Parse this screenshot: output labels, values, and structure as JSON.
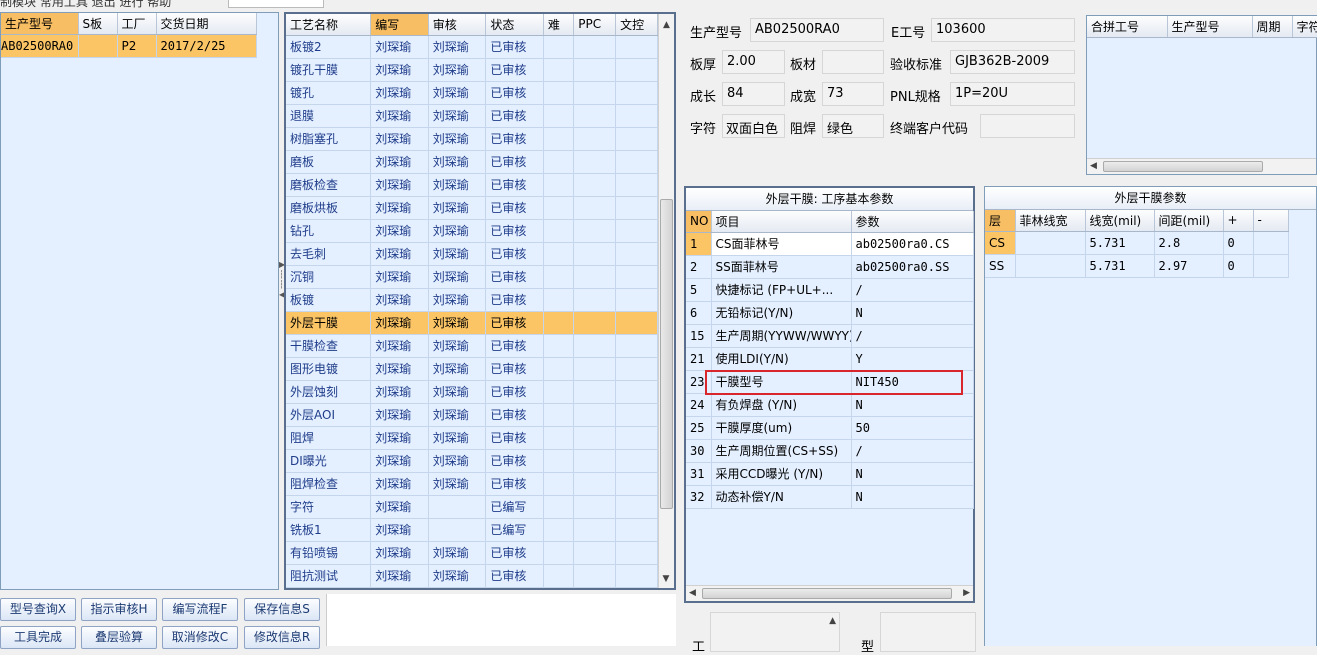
{
  "top_menu_fragment": "制模块  常用工具  退出  进行  帮助",
  "left_grid": {
    "headers": [
      "生产型号",
      "S板",
      "工厂",
      "交货日期"
    ],
    "rows": [
      [
        "AB02500RA0",
        "",
        "P2",
        "2017/2/25"
      ]
    ]
  },
  "process_grid": {
    "headers": [
      "工艺名称",
      "编写",
      "审核",
      "状态",
      "难",
      "PPC",
      "文控"
    ],
    "rows": [
      [
        "板镀2",
        "刘琛瑜",
        "刘琛瑜",
        "已审核"
      ],
      [
        "镀孔干膜",
        "刘琛瑜",
        "刘琛瑜",
        "已审核"
      ],
      [
        "镀孔",
        "刘琛瑜",
        "刘琛瑜",
        "已审核"
      ],
      [
        "退膜",
        "刘琛瑜",
        "刘琛瑜",
        "已审核"
      ],
      [
        "树脂塞孔",
        "刘琛瑜",
        "刘琛瑜",
        "已审核"
      ],
      [
        "磨板",
        "刘琛瑜",
        "刘琛瑜",
        "已审核"
      ],
      [
        "磨板检查",
        "刘琛瑜",
        "刘琛瑜",
        "已审核"
      ],
      [
        "磨板烘板",
        "刘琛瑜",
        "刘琛瑜",
        "已审核"
      ],
      [
        "钻孔",
        "刘琛瑜",
        "刘琛瑜",
        "已审核"
      ],
      [
        "去毛刺",
        "刘琛瑜",
        "刘琛瑜",
        "已审核"
      ],
      [
        "沉铜",
        "刘琛瑜",
        "刘琛瑜",
        "已审核"
      ],
      [
        "板镀",
        "刘琛瑜",
        "刘琛瑜",
        "已审核"
      ],
      [
        "外层干膜",
        "刘琛瑜",
        "刘琛瑜",
        "已审核"
      ],
      [
        "干膜检查",
        "刘琛瑜",
        "刘琛瑜",
        "已审核"
      ],
      [
        "图形电镀",
        "刘琛瑜",
        "刘琛瑜",
        "已审核"
      ],
      [
        "外层蚀刻",
        "刘琛瑜",
        "刘琛瑜",
        "已审核"
      ],
      [
        "外层AOI",
        "刘琛瑜",
        "刘琛瑜",
        "已审核"
      ],
      [
        "阻焊",
        "刘琛瑜",
        "刘琛瑜",
        "已审核"
      ],
      [
        "DI曝光",
        "刘琛瑜",
        "刘琛瑜",
        "已审核"
      ],
      [
        "阻焊检查",
        "刘琛瑜",
        "刘琛瑜",
        "已审核"
      ],
      [
        "字符",
        "刘琛瑜",
        "",
        "已编写"
      ],
      [
        "铣板1",
        "刘琛瑜",
        "",
        "已编写"
      ],
      [
        "有铅喷锡",
        "刘琛瑜",
        "刘琛瑜",
        "已审核"
      ],
      [
        "阻抗测试",
        "刘琛瑜",
        "刘琛瑜",
        "已审核"
      ]
    ]
  },
  "info": {
    "model_label": "生产型号",
    "model_value": "AB02500RA0",
    "eno_label": "E工号",
    "eno_value": "103600",
    "thick_label": "板厚",
    "thick_value": "2.00",
    "material_label": "板材",
    "material_value": "",
    "standard_label": "验收标准",
    "standard_value": "GJB362B-2009",
    "length_label": "成长",
    "length_value": "84",
    "width_label": "成宽",
    "width_value": "73",
    "pnl_label": "PNL规格",
    "pnl_value": "1P=20U",
    "char_label": "字符",
    "char_value": "双面白色",
    "mask_label": "阻焊",
    "mask_value": "绿色",
    "customer_label": "终端客户代码",
    "customer_value": ""
  },
  "merge_grid": {
    "headers": [
      "合拼工号",
      "生产型号",
      "周期",
      "字符"
    ]
  },
  "params": {
    "title": "外层干膜: 工序基本参数",
    "headers": [
      "NO",
      "项目",
      "参数"
    ],
    "rows": [
      [
        "1",
        "CS面菲林号",
        "ab02500ra0.CS"
      ],
      [
        "2",
        "SS面菲林号",
        "ab02500ra0.SS"
      ],
      [
        "5",
        "快捷标记 (FP+UL+...",
        "/"
      ],
      [
        "6",
        "无铅标记(Y/N)",
        "N"
      ],
      [
        "15",
        "生产周期(YYWW/WWYY)",
        "/"
      ],
      [
        "21",
        "使用LDI(Y/N)",
        "Y"
      ],
      [
        "23",
        "干膜型号",
        "NIT450"
      ],
      [
        "24",
        "有负焊盘 (Y/N)",
        "N"
      ],
      [
        "25",
        "干膜厚度(um)",
        "50"
      ],
      [
        "30",
        "生产周期位置(CS+SS)",
        "/"
      ],
      [
        "31",
        "采用CCD曝光 (Y/N)",
        "N"
      ],
      [
        "32",
        "动态补偿Y/N",
        "N"
      ]
    ]
  },
  "film": {
    "title": "外层干膜参数",
    "headers": [
      "层",
      "菲林线宽",
      "线宽(mil)",
      "间距(mil)",
      "+",
      "-"
    ],
    "rows": [
      [
        "CS",
        "",
        "5.731",
        "2.8",
        "0",
        ""
      ],
      [
        "SS",
        "",
        "5.731",
        "2.97",
        "0",
        ""
      ]
    ]
  },
  "buttons": {
    "b1": "型号查询X",
    "b2": "指示审核H",
    "b3": "编写流程F",
    "b4": "保存信息S",
    "b5": "工具完成",
    "b6": "叠层验算",
    "b7": "取消修改C",
    "b8": "修改信息R"
  },
  "bottom_left_label": "工",
  "bottom_mid_label": "型"
}
